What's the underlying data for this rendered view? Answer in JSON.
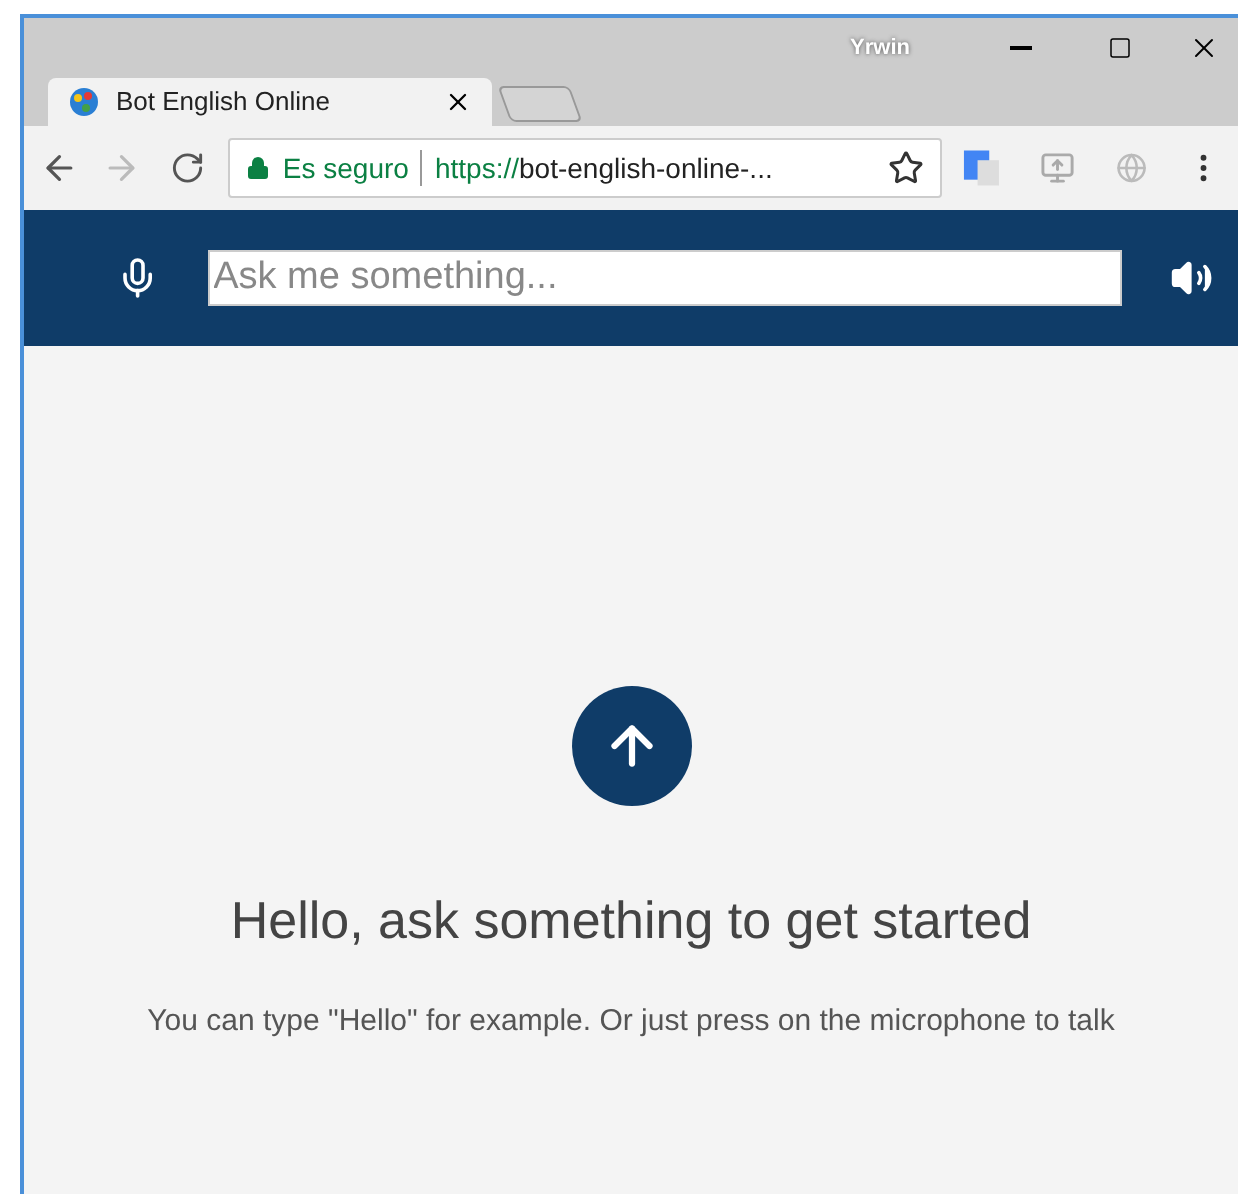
{
  "window": {
    "user": "Yrwin"
  },
  "tabs": [
    {
      "title": "Bot English Online",
      "selected": true
    }
  ],
  "address_bar": {
    "security": "Es seguro",
    "scheme": "https://",
    "rest": "bot-english-online-..."
  },
  "header": {
    "placeholder": "Ask me something..."
  },
  "content": {
    "heading": "Hello, ask something to get started",
    "hint": "You can type \"Hello\" for example. Or just press on the microphone to talk"
  }
}
